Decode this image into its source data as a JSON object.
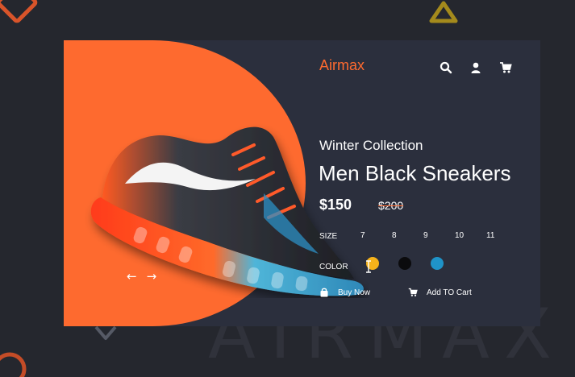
{
  "brand": "Airmax",
  "watermark": "AIRMAX",
  "nav": {
    "icons": [
      "search-icon",
      "user-icon",
      "cart-icon"
    ]
  },
  "product": {
    "collection": "Winter Collection",
    "name": "Men Black Sneakers",
    "price": "$150",
    "old_price": "$200"
  },
  "size": {
    "label": "SIZE",
    "options": [
      "7",
      "8",
      "9",
      "10",
      "11"
    ]
  },
  "color": {
    "label": "COLOR",
    "options": [
      "#f5b21a",
      "#0b0b0d",
      "#1f93c8"
    ]
  },
  "actions": {
    "buy_now": "Buy Now",
    "add_to_cart": "Add TO Cart"
  },
  "carousel": {
    "prev": "←",
    "next": "→"
  },
  "colors": {
    "accent": "#fe6a2f",
    "background": "#25272e",
    "card": "#2b2f3d"
  }
}
